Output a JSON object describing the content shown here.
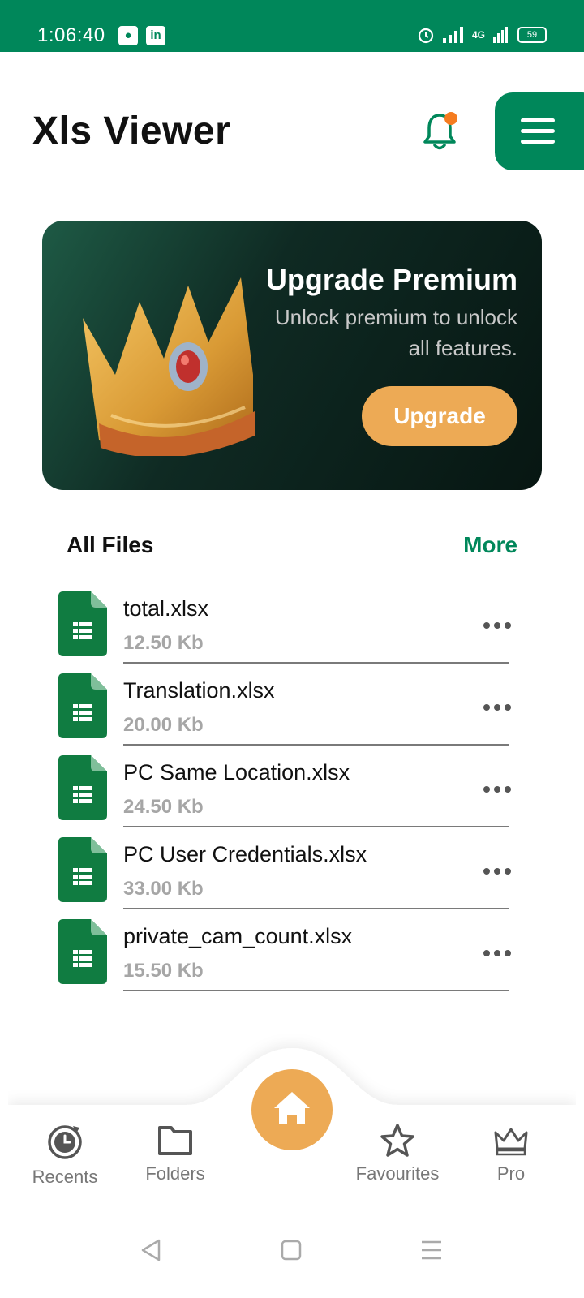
{
  "status_bar": {
    "time": "1:06:40",
    "network": "4G",
    "battery": "59"
  },
  "header": {
    "title": "Xls Viewer"
  },
  "banner": {
    "title": "Upgrade Premium",
    "subtitle": "Unlock premium to unlock all features.",
    "button": "Upgrade"
  },
  "files_section": {
    "title": "All Files",
    "more": "More",
    "files": [
      {
        "name": "total.xlsx",
        "size": "12.50 Kb"
      },
      {
        "name": "Translation.xlsx",
        "size": "20.00 Kb"
      },
      {
        "name": "PC Same Location.xlsx",
        "size": "24.50 Kb"
      },
      {
        "name": "PC User Credentials.xlsx",
        "size": "33.00 Kb"
      },
      {
        "name": "private_cam_count.xlsx",
        "size": "15.50 Kb"
      }
    ]
  },
  "bottom_nav": {
    "items": [
      {
        "label": "Recents",
        "icon": "recents-icon"
      },
      {
        "label": "Folders",
        "icon": "folder-icon"
      },
      {
        "label": "Favourites",
        "icon": "star-icon"
      },
      {
        "label": "Pro",
        "icon": "crown-icon"
      }
    ],
    "home_icon": "home-icon"
  },
  "colors": {
    "primary": "#00875a",
    "accent": "#edaa55",
    "notification": "#f57c20"
  }
}
